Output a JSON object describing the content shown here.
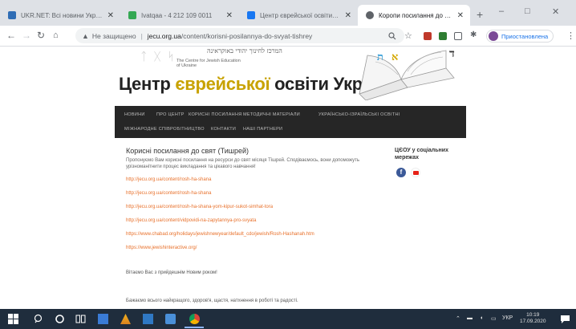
{
  "browser": {
    "tabs": [
      {
        "title": "UKR.NET: Всі новини України",
        "active": false,
        "favicon_color": "#2f6db5"
      },
      {
        "title": "Ivatqaa - 4 212 109 0011",
        "active": false,
        "favicon_color": "#34a853"
      },
      {
        "title": "Центр єврейської освіти Ук",
        "active": false,
        "favicon_color": "#1877f2"
      },
      {
        "title": "Коропи посилання до свят",
        "active": true,
        "favicon_color": "#5f6368"
      }
    ],
    "new_tab": "+",
    "window_controls": [
      "–",
      "□",
      "✕"
    ],
    "address": {
      "security_label": "Не защищено",
      "url_host": "jecu.org.ua",
      "url_path": "/content/korisni-posilannya-do-svyat-tishrey"
    },
    "profile_label": "Приостановлена"
  },
  "site": {
    "hebrew_line": "המרכז לחינוך יהודי באוקראינה",
    "small_heading": [
      "The Centre for Jewish Education",
      "of Ukraine"
    ],
    "title_part1": "Центр ",
    "title_part2": "єврейської",
    "title_part3": " освіти України",
    "nav": [
      "Новини",
      "Про центр",
      "Корисні посилання",
      "Методичні матеріали",
      "Українсько-ізраїльські освітні",
      "Міжнародне співробітництво",
      "Контакти",
      "Наші партнери"
    ]
  },
  "post": {
    "title": "Корисні посилання до свят (Тишрей)",
    "intro": "Пропонуємо Вам корисні посилання на ресурси до свят місяця Тішрей. Сподіваємось, вони допоможуть урізноманітнити процес викладання та цікавого навчання!",
    "links": [
      "http://jecu.org.ua/content/rosh-ha-shana",
      "http://jecu.org.ua/content/rosh-ha-shana",
      "http://jecu.org.ua/content/rosh-ha-shana-yom-kipur-sukot-simhat-tora",
      "http://jecu.org.ua/content/vidpovidi-na-zapytannya-pro-svyata",
      "https://www.chabad.org/holidays/jewishnewyear/default_cdo/jewish/Rosh-Hashanah.htm",
      "https://www.jewishinteractive.org/"
    ],
    "greeting1": "Вітаємо Вас з прийдешнім Новим роком!",
    "greeting2": "Бажаємо всього найкращого, здоров'я, щастя, натхнення в роботі та радості."
  },
  "sidebar": {
    "social_title": "ЦЄОУ у соціальних мережах",
    "facebook_glyph": "f"
  },
  "taskbar": {
    "language": "УКР",
    "time": "10:19",
    "date": "17.09.2020"
  }
}
